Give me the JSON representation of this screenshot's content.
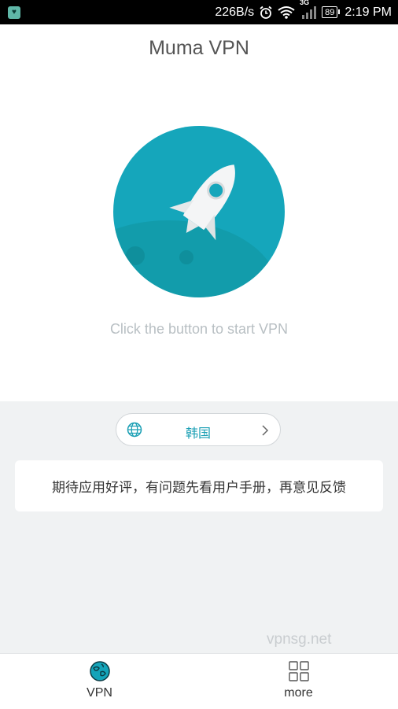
{
  "status_bar": {
    "net_speed": "226B/s",
    "network_type": "3G",
    "battery": "89",
    "time": "2:19 PM",
    "icons": [
      "app-notification-icon",
      "alarm-clock-icon",
      "wifi-icon",
      "signal-icon",
      "battery-icon"
    ]
  },
  "header": {
    "title": "Muma VPN"
  },
  "connect": {
    "hint": "Click the button to start VPN",
    "icon": "rocket-icon",
    "accent_color": "#15a6bb"
  },
  "region": {
    "name": "韩国",
    "icon": "globe-icon",
    "chevron": "chevron-right-icon"
  },
  "notice": {
    "text": "期待应用好评，有问题先看用户手册，再意见反馈"
  },
  "watermark": "vpnsg.net",
  "bottom_nav": {
    "items": [
      {
        "label": "VPN",
        "icon": "globe-icon"
      },
      {
        "label": "more",
        "icon": "grid-icon"
      }
    ]
  }
}
